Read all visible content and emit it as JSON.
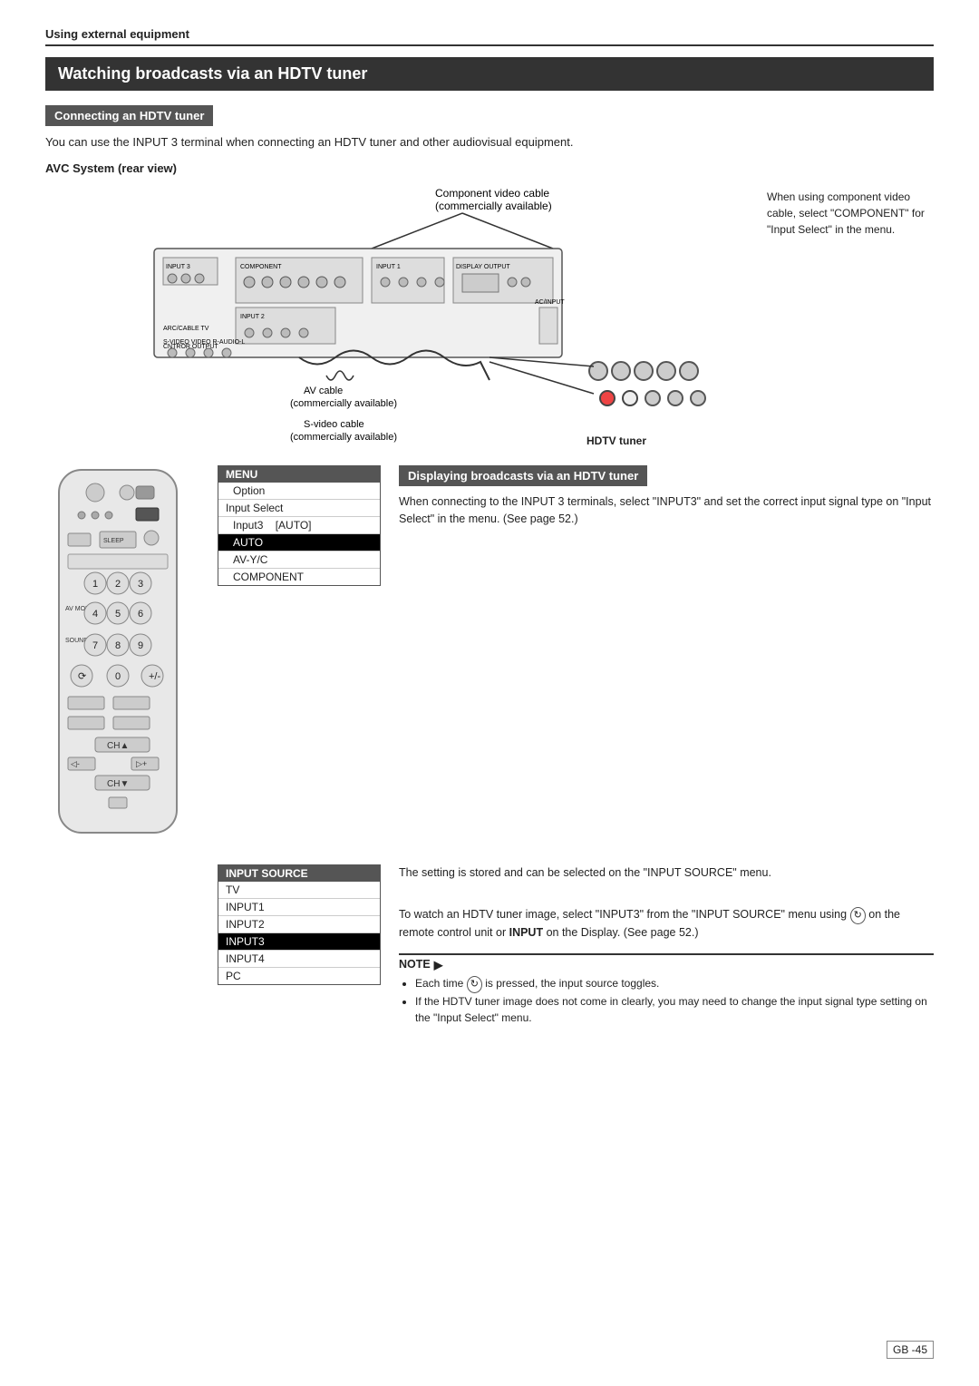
{
  "header": {
    "title": "Using external equipment"
  },
  "section": {
    "title": "Watching broadcasts via an HDTV tuner"
  },
  "connecting": {
    "subtitle": "Connecting an HDTV tuner",
    "intro": "You can use the INPUT 3 terminal when connecting an HDTV tuner and other audiovisual equipment.",
    "avc_label": "AVC System (rear view)",
    "component_cable": "Component  video cable\n(commercially available)",
    "av_cable": "AV cable\n(commercially available)",
    "svideo_cable": "S-video cable\n(commercially available)",
    "right_note": "When using component video cable, select \"COMPONENT\" for \"Input Select\" in the menu.",
    "hdtv_label": "HDTV tuner"
  },
  "displaying": {
    "subtitle": "Displaying broadcasts via an HDTV tuner",
    "description": "When connecting to the INPUT 3 terminals, select \"INPUT3\" and set the correct input signal type on \"Input Select\" in the menu. (See page 52.)"
  },
  "menu": {
    "header": "MENU",
    "items": [
      {
        "label": "Option",
        "indent": 1,
        "selected": false
      },
      {
        "label": "Input Select",
        "indent": 0,
        "selected": false
      },
      {
        "label": "Input3      [AUTO]",
        "indent": 1,
        "selected": false
      },
      {
        "label": "AUTO",
        "indent": 1,
        "selected": true
      },
      {
        "label": "AV-Y/C",
        "indent": 1,
        "selected": false
      },
      {
        "label": "COMPONENT",
        "indent": 1,
        "selected": false
      }
    ]
  },
  "input_source": {
    "header": "INPUT SOURCE",
    "items": [
      {
        "label": "TV",
        "selected": false
      },
      {
        "label": "INPUT1",
        "selected": false
      },
      {
        "label": "INPUT2",
        "selected": false
      },
      {
        "label": "INPUT3",
        "selected": true
      },
      {
        "label": "INPUT4",
        "selected": false
      },
      {
        "label": "PC",
        "selected": false
      }
    ],
    "description1": "The setting is stored and can be selected on the \"INPUT SOURCE\" menu.",
    "description2": "To watch an HDTV tuner image, select \"INPUT3\" from the \"INPUT SOURCE\" menu using  on the remote control unit or INPUT on the Display. (See page 52.)"
  },
  "note": {
    "header": "NOTE",
    "items": [
      "Each time  is pressed, the input source toggles.",
      "If the HDTV tuner image does not come in clearly, you may need to change the input signal type setting on the \"Input Select\" menu."
    ]
  },
  "page_number": "GB -45"
}
